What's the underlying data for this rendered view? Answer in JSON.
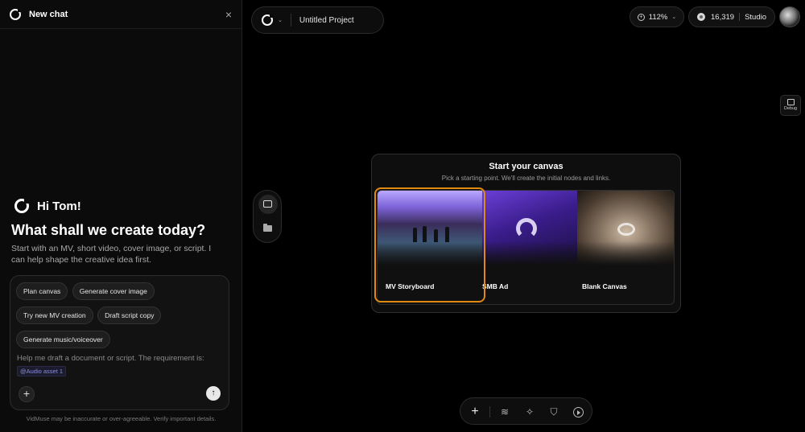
{
  "left_panel": {
    "title": "New chat",
    "close_icon": "×",
    "greeting": "Hi Tom!",
    "headline": "What shall we create today?",
    "subtitle": "Start with an MV, short video, cover image, or script. I can help shape the creative idea first.",
    "chips": [
      {
        "label": "Plan canvas"
      },
      {
        "label": "Generate cover image"
      },
      {
        "label": "Try new MV creation"
      },
      {
        "label": "Draft script copy"
      },
      {
        "label": "Generate music/voiceover"
      }
    ],
    "input_text": "Help me draft a document or script. The requirement is:",
    "audio_tag": "@Audio asset 1",
    "add_icon": "+",
    "send_icon": "↑",
    "disclaimer": "VidMuse may be inaccurate or over-agreeable. Verify important details."
  },
  "topbar": {
    "project_name": "Untitled Project",
    "chevron": "⌄",
    "zoom": "112%",
    "zoom_chevron": "⌄",
    "zoom_icon": "+",
    "credits": "16,319",
    "plan": "Studio"
  },
  "debug": {
    "label": "Debug"
  },
  "canvas_card": {
    "title": "Start your canvas",
    "subtitle": "Pick a starting point. We'll create the initial nodes and links.",
    "options": [
      {
        "label": "MV Storyboard"
      },
      {
        "label": "SMB Ad"
      },
      {
        "label": "Blank Canvas"
      }
    ]
  },
  "bottom_toolbar": {
    "plus": "+",
    "layers": "≋",
    "magic": "✧",
    "map": "⛉"
  },
  "colors": {
    "background": "#000000",
    "panel": "#0b0b0b",
    "highlight": "#e08a12"
  }
}
